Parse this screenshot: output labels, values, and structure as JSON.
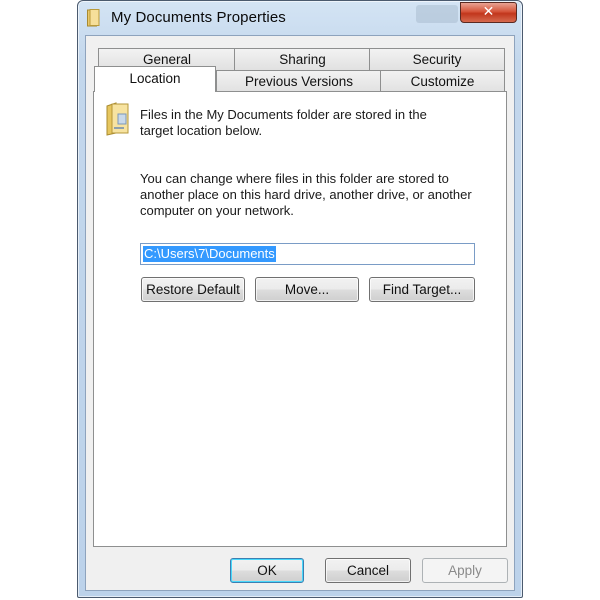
{
  "window": {
    "title": "My Documents Properties",
    "close_glyph": "✕"
  },
  "tabs_back": [
    {
      "label": "General",
      "name": "tab-general"
    },
    {
      "label": "Sharing",
      "name": "tab-sharing"
    },
    {
      "label": "Security",
      "name": "tab-security"
    }
  ],
  "tabs_front": [
    {
      "label": "Location",
      "name": "tab-location",
      "active": true
    },
    {
      "label": "Previous Versions",
      "name": "tab-previous-versions",
      "active": false
    },
    {
      "label": "Customize",
      "name": "tab-customize",
      "active": false
    }
  ],
  "location": {
    "info_line1": "Files in the My Documents folder are stored in the",
    "info_line2": "target location below.",
    "change_line1": "You can change where files in this folder are stored to",
    "change_line2": "another place on this hard drive, another drive, or another",
    "change_line3": "computer on your network.",
    "path_value": "C:\\Users\\7\\Documents",
    "restore_default": "Restore Default",
    "move": "Move...",
    "find_target": "Find Target..."
  },
  "footer": {
    "ok": "OK",
    "cancel": "Cancel",
    "apply": "Apply",
    "apply_enabled": false
  },
  "colors": {
    "selection": "#3399ff",
    "close_button": "#c1361c",
    "frame": "#c3d7ec"
  },
  "icons": {
    "title": "folder-icon",
    "content": "folder-icon",
    "close": "close-icon"
  }
}
